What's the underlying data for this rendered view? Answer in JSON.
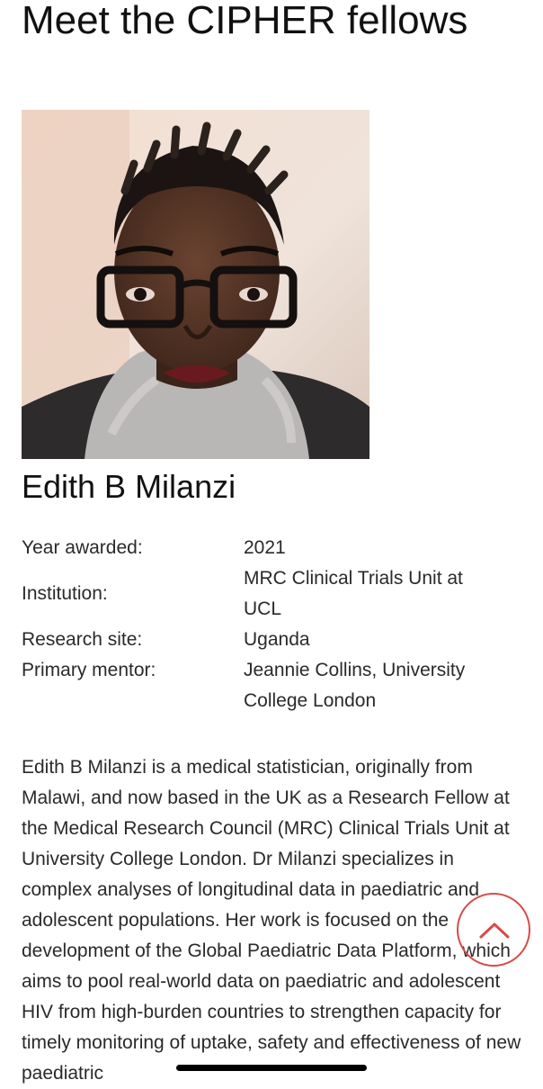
{
  "page": {
    "title": "Meet the CIPHER fellows"
  },
  "fellow": {
    "name": "Edith B Milanzi",
    "photo_icon": "portrait-photo",
    "details": [
      {
        "label": "Year awarded:",
        "value": "2021"
      },
      {
        "label": "Institution:",
        "value": "MRC Clinical Trials Unit at UCL"
      },
      {
        "label": "Research site:",
        "value": "Uganda"
      },
      {
        "label": "Primary mentor:",
        "value": "Jeannie Collins, University College London"
      }
    ],
    "bio": "Edith B Milanzi is a medical statistician, originally from Malawi, and now based in the UK as a Research Fellow at the Medical Research Council (MRC) Clinical Trials Unit at University College London. Dr Milanzi specializes in complex analyses of longitudinal data in paediatric and adolescent populations. Her work is focused on the development of the Global Paediatric Data Platform, which aims to pool real-world data on paediatric and adolescent HIV from high-burden countries to strengthen capacity for timely monitoring of uptake, safety and effectiveness of new paediatric"
  },
  "scroll_top": {
    "icon": "chevron-up-icon",
    "color": "#d94a4a"
  },
  "colors": {
    "text": "#2a2a2a",
    "title": "#111111",
    "accent": "#d94a4a"
  }
}
